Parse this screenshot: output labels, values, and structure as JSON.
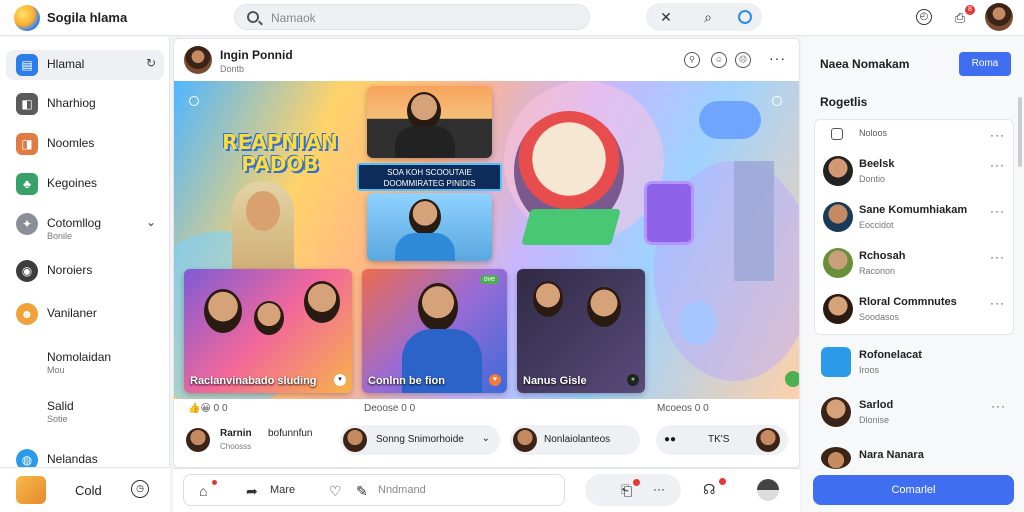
{
  "app": {
    "title": "Sogila hlama"
  },
  "search": {
    "placeholder": "Namaok"
  },
  "topbar": {
    "tools": [
      "close-x-icon",
      "search-icon",
      "ring-icon"
    ],
    "notification_badge": "8"
  },
  "sidebar": {
    "items": [
      {
        "label": "Hlamal",
        "sub": "",
        "extra": "refresh-icon",
        "color": "#2b7de9",
        "glyph": "▤"
      },
      {
        "label": "Nharhiog",
        "sub": "",
        "extra": "",
        "color": "#5b5b5b",
        "glyph": "◧"
      },
      {
        "label": "Noomles",
        "sub": "",
        "extra": "",
        "color": "#e07b43",
        "glyph": "◨"
      },
      {
        "label": "Kegoines",
        "sub": "",
        "extra": "",
        "color": "#38a169",
        "glyph": "♣"
      },
      {
        "label": "Cotomllog",
        "sub": "Bonile",
        "extra": "⌄",
        "color": "#8a8f98",
        "glyph": "✦"
      },
      {
        "label": "Noroiers",
        "sub": "",
        "extra": "",
        "color": "#3d3d3d",
        "glyph": "◉"
      },
      {
        "label": "Vanilaner",
        "sub": "",
        "extra": "",
        "color": "#f2a23a",
        "glyph": "☻"
      },
      {
        "label": "Nomolaidan",
        "sub": "Mou",
        "extra": "",
        "color": "",
        "glyph": ""
      },
      {
        "label": "Salid",
        "sub": "Sotie",
        "extra": "",
        "color": "",
        "glyph": ""
      },
      {
        "label": "Nelandas",
        "sub": "",
        "extra": "",
        "color": "#2b9be9",
        "glyph": "◍"
      }
    ],
    "footer": {
      "label": "Cold"
    }
  },
  "post": {
    "author": "Ingin Ponnid",
    "subtitle": "Dontb",
    "hero": {
      "headline": "REAPNIAN PADOB",
      "banner": "SOA KOH SCOOUTAIE DOOMMIRATEG PINIDIS",
      "photos": [
        {
          "caption": "",
          "tag": ""
        },
        {
          "caption": "",
          "tag": ""
        },
        {
          "caption": "Raclanvinabado sluding",
          "tag": "▾"
        },
        {
          "caption": "Conlnn be fion",
          "tag": "♥"
        },
        {
          "caption": "Nanus Gisle",
          "tag": "●"
        }
      ],
      "live_badge": "ove"
    },
    "reactions": [
      {
        "text": "0 0"
      },
      {
        "text": "Deoose 0 0"
      },
      {
        "text": "Mcoeos 0 0"
      }
    ],
    "comments": [
      {
        "name": "Rarnin",
        "text": "bofunnfun",
        "sub": "Choosss"
      },
      {
        "name": "",
        "text": "Sonng Snimorhoide",
        "sub": ""
      },
      {
        "name": "",
        "text": "Nonlaiolanteos",
        "sub": ""
      },
      {
        "name": "",
        "text": "TK'S",
        "sub": ""
      }
    ]
  },
  "composer": {
    "items": [
      {
        "label": "",
        "icon": "home-icon"
      },
      {
        "label": "Mare",
        "icon": "share-icon"
      },
      {
        "label": "",
        "icon": "chat-icon"
      },
      {
        "label": "Nndmand",
        "icon": "edit-icon"
      }
    ]
  },
  "rightpanel": {
    "title": "Naea Nomakam",
    "button": "Roma",
    "section": "Rogetlis",
    "card_items": [
      {
        "name": "Noloos",
        "sub": ""
      },
      {
        "name": "Beelsk",
        "sub": "Dontio"
      },
      {
        "name": "Sane Komumhiakam",
        "sub": "Eoccidot"
      },
      {
        "name": "Rchosah",
        "sub": "Raconon"
      },
      {
        "name": "Rloral Commnutes",
        "sub": "Soodasos"
      }
    ],
    "list_items": [
      {
        "name": "Rofonelacat",
        "sub": "Iroos"
      },
      {
        "name": "Sarlod",
        "sub": "Dlonise"
      },
      {
        "name": "Nara Nanara",
        "sub": ""
      }
    ],
    "cta": "Comarlel"
  },
  "colors": {
    "accent": "#3f6ef0",
    "badge": "#e53935"
  }
}
